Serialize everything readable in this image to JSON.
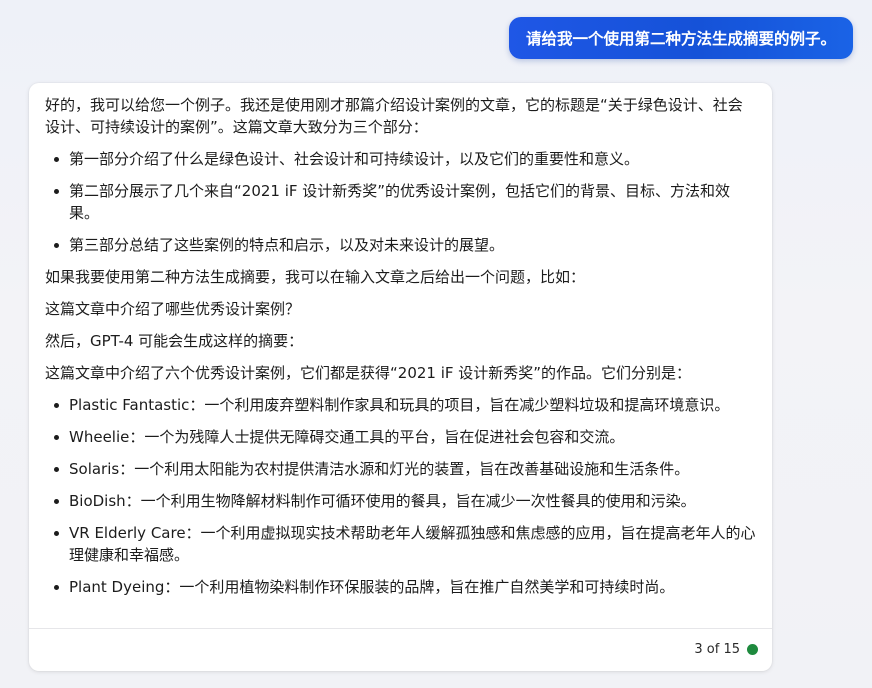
{
  "user_message": "请给我一个使用第二种方法生成摘要的例子。",
  "reply": {
    "intro": "好的，我可以给您一个例子。我还是使用刚才那篇介绍设计案例的文章，它的标题是“关于绿色设计、社会设计、可持续设计的案例”。这篇文章大致分为三个部分：",
    "parts": [
      "第一部分介绍了什么是绿色设计、社会设计和可持续设计，以及它们的重要性和意义。",
      "第二部分展示了几个来自“2021 iF 设计新秀奖”的优秀设计案例，包括它们的背景、目标、方法和效果。",
      "第三部分总结了这些案例的特点和启示，以及对未来设计的展望。"
    ],
    "method_text": "如果我要使用第二种方法生成摘要，我可以在输入文章之后给出一个问题，比如：",
    "question": "这篇文章中介绍了哪些优秀设计案例？",
    "then_text": "然后，GPT-4 可能会生成这样的摘要：",
    "summary_intro": "这篇文章中介绍了六个优秀设计案例，它们都是获得“2021 iF 设计新秀奖”的作品。它们分别是：",
    "cases": [
      "Plastic Fantastic：一个利用废弃塑料制作家具和玩具的项目，旨在减少塑料垃圾和提高环境意识。",
      "Wheelie：一个为残障人士提供无障碍交通工具的平台，旨在促进社会包容和交流。",
      "Solaris：一个利用太阳能为农村提供清洁水源和灯光的装置，旨在改善基础设施和生活条件。",
      "BioDish：一个利用生物降解材料制作可循环使用的餐具，旨在减少一次性餐具的使用和污染。",
      "VR Elderly Care：一个利用虚拟现实技术帮助老年人缓解孤独感和焦虑感的应用，旨在提高老年人的心理健康和幸福感。",
      "Plant Dyeing：一个利用植物染料制作环保服装的品牌，旨在推广自然美学和可持续时尚。"
    ]
  },
  "footer": {
    "turn_counter": "3 of 15",
    "status_color": "#1e8a3e"
  }
}
